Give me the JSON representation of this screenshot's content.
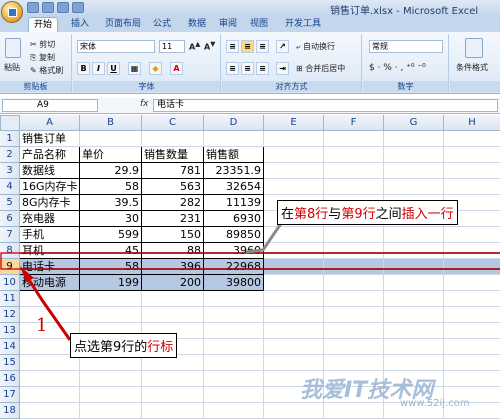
{
  "window": {
    "title": "销售订单.xlsx - Microsoft Excel"
  },
  "tabs": [
    "开始",
    "插入",
    "页面布局",
    "公式",
    "数据",
    "审阅",
    "视图",
    "开发工具"
  ],
  "ribbon": {
    "clipboard": {
      "label": "剪贴板",
      "paste": "粘贴",
      "cut": "剪切",
      "copy": "复制",
      "format_painter": "格式刷"
    },
    "font": {
      "label": "字体",
      "name": "宋体",
      "size": "11",
      "bold": "B",
      "italic": "I",
      "underline": "U"
    },
    "alignment": {
      "label": "对齐方式",
      "wrap": "自动换行",
      "merge": "合并后居中"
    },
    "number": {
      "label": "数字",
      "format": "常规"
    },
    "styles": {
      "conditional": "条件格式"
    }
  },
  "formula_bar": {
    "name_box": "A9",
    "fx": "fx",
    "content": "电话卡"
  },
  "columns": [
    "A",
    "B",
    "C",
    "D",
    "E",
    "F",
    "G",
    "H"
  ],
  "rows": [
    "1",
    "2",
    "3",
    "4",
    "5",
    "6",
    "7",
    "8",
    "9",
    "10",
    "11",
    "12",
    "13",
    "14",
    "15",
    "16",
    "17",
    "18"
  ],
  "sheet": {
    "title": "销售订单",
    "headers": [
      "产品名称",
      "单价",
      "销售数量",
      "销售额"
    ],
    "data": [
      [
        "数据线",
        "29.9",
        "781",
        "23351.9"
      ],
      [
        "16G内存卡",
        "58",
        "563",
        "32654"
      ],
      [
        "8G内存卡",
        "39.5",
        "282",
        "11139"
      ],
      [
        "充电器",
        "30",
        "231",
        "6930"
      ],
      [
        "手机",
        "599",
        "150",
        "89850"
      ],
      [
        "耳机",
        "45",
        "88",
        "3960"
      ],
      [
        "电话卡",
        "58",
        "396",
        "22968"
      ],
      [
        "移动电源",
        "199",
        "200",
        "39800"
      ]
    ]
  },
  "annotations": {
    "insert_callout": {
      "p1": "在",
      "p2": "第8行",
      "p3": "与",
      "p4": "第9行",
      "p5": "之间",
      "p6": "插入一行"
    },
    "step_number": "1",
    "select_callout": {
      "p1": "点选第9行的",
      "p2": "行标"
    }
  },
  "watermark": {
    "main": "我爱IT技术网",
    "sub": "www.52ij.com"
  }
}
